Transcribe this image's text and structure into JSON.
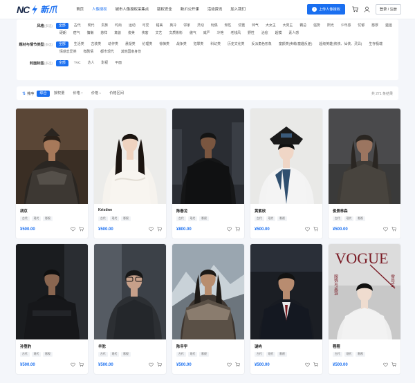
{
  "brand": {
    "logo_text": "NC",
    "logo_cn": "新爪"
  },
  "nav": [
    {
      "label": "首页",
      "active": false
    },
    {
      "label": "人像授权",
      "active": true
    },
    {
      "label": "城市人像授权采集点",
      "active": false
    },
    {
      "label": "版权安全",
      "active": false
    },
    {
      "label": "新爪公开课",
      "active": false
    },
    {
      "label": "活动资讯",
      "active": false
    },
    {
      "label": "加入我们",
      "active": false
    }
  ],
  "header": {
    "upload_label": "上传人像授权",
    "login_label": "登录 / 注册"
  },
  "filters": [
    {
      "label": "风格",
      "mult": "(多选)",
      "options": [
        "全部",
        "古代",
        "现代",
        "贵族",
        "时尚",
        "运动",
        "可爱",
        "甜美",
        "英冷",
        "邻家",
        "灵动",
        "玩偶",
        "知性",
        "优雅",
        "帅气",
        "大女主",
        "大男主",
        "霸总",
        "强势",
        "阳光",
        "少年感",
        "忧郁",
        "憨厚",
        "邋遢",
        "硬朗",
        "痞气",
        "慵懒",
        "慈祥",
        "禽兽",
        "俊美",
        "侠客",
        "文艺",
        "文质彬彬",
        "傲气",
        "威严",
        "冷艳",
        "老钱风",
        "野性",
        "治愈",
        "超模",
        "素人感"
      ]
    },
    {
      "label": "题材与情节类型",
      "mult": "(多选)",
      "options": [
        "全部",
        "生活类",
        "古装类",
        "动作类",
        "悬疑类",
        "伦理类",
        "惊悚类",
        "战争类",
        "犯罪类",
        "科幻类",
        "历史文化类",
        "反派角色形象",
        "童颜类(卖萌/童趣反差)",
        "超级英雄(侠侠、仙侠、灵异)",
        "生存极端",
        "情感恋爱类",
        "微剧情",
        "都市现代",
        "其他国家身份"
      ]
    },
    {
      "label": "封面标签",
      "mult": "(多选)",
      "options": [
        "全部",
        "TVC",
        "达人",
        "影视",
        "平面"
      ]
    }
  ],
  "sortbar": {
    "sort_label": "排序",
    "options": [
      "综合",
      "授权量",
      "价格 ↑",
      "价格 ↓",
      "价格区间"
    ],
    "active_index": 0,
    "total_text": "共 271 条结果"
  },
  "cards": [
    {
      "name": "胡京",
      "tags": [
        "古代",
        "现代",
        "影视"
      ],
      "price": "¥500.00",
      "photo": "warrior"
    },
    {
      "name": "Kristine",
      "tags": [
        "古代",
        "现代",
        "影视"
      ],
      "price": "¥500.00",
      "photo": "woman-white"
    },
    {
      "name": "陈春龙",
      "tags": [
        "古代",
        "现代",
        "影视"
      ],
      "price": "¥800.00",
      "photo": "man-dark-city"
    },
    {
      "name": "黄紫欣",
      "tags": [
        "古代",
        "现代",
        "影视"
      ],
      "price": "¥500.00",
      "photo": "qing-woman"
    },
    {
      "name": "俊景林森",
      "tags": [
        "古代",
        "现代",
        "影视"
      ],
      "price": "¥500.00",
      "photo": "wanderer"
    },
    {
      "name": "孙登豹",
      "tags": [
        "古代",
        "现代",
        "影视"
      ],
      "price": "¥500.00",
      "photo": "soldier"
    },
    {
      "name": "羊驼",
      "tags": [
        "古代",
        "现代",
        "影视"
      ],
      "price": "¥500.00",
      "photo": "glasses-man"
    },
    {
      "name": "陈辛宇",
      "tags": [
        "古代",
        "现代",
        "影视"
      ],
      "price": "¥500.00",
      "photo": "mountain-man"
    },
    {
      "name": "谜屿",
      "tags": [
        "古代",
        "现代",
        "影视"
      ],
      "price": "¥500.00",
      "photo": "suit-man"
    },
    {
      "name": "程程",
      "tags": [
        "古代",
        "现代",
        "影视"
      ],
      "price": "¥500.00",
      "photo": "vogue"
    }
  ],
  "vogue_cover": {
    "masthead": "VOGUE",
    "side_text_1": "服饰与美容",
    "side_text_2": "雪与生"
  },
  "colors": {
    "accent": "#1a6ff0",
    "page_bg": "#f4f6fa"
  }
}
